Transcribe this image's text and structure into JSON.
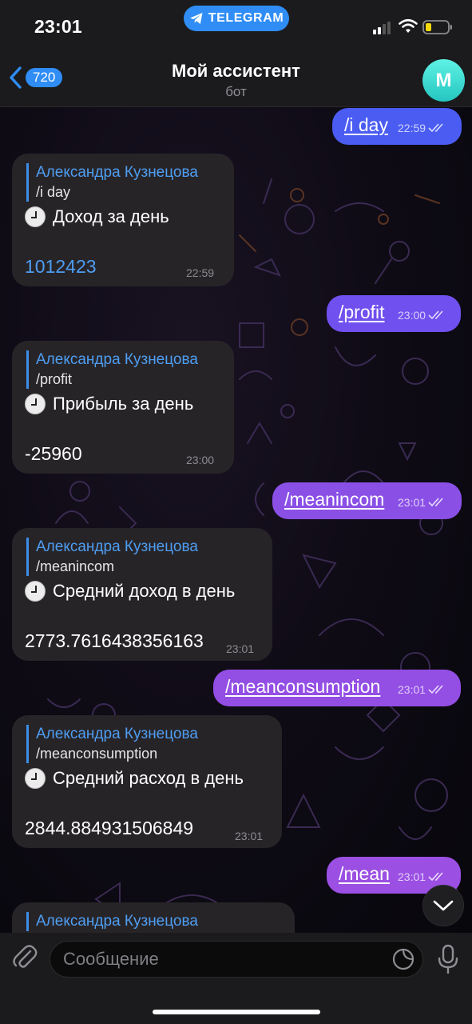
{
  "status_bar": {
    "time": "23:01",
    "pill_label": "TELEGRAM",
    "battery_color": "#f5d90a",
    "icons": [
      "signal-icon",
      "wifi-icon",
      "battery-icon"
    ]
  },
  "header": {
    "back_count": "720",
    "title": "Мой ассистент",
    "subtitle": "бот",
    "avatar_letter": "М",
    "accent": "#2f8df5"
  },
  "messages": [
    {
      "from": "me",
      "text": "/i day",
      "time": "22:59"
    },
    {
      "from": "bot",
      "reply_name": "Александра Кузнецова",
      "reply_text": "/i day",
      "title": "Доход за день",
      "value": "1012423",
      "value_is_link": true,
      "time": "22:59"
    },
    {
      "from": "me",
      "text": "/profit",
      "time": "23:00"
    },
    {
      "from": "bot",
      "reply_name": "Александра Кузнецова",
      "reply_text": "/profit",
      "title": "Прибыль за день",
      "value": "-25960",
      "time": "23:00"
    },
    {
      "from": "me",
      "text": "/meanincom",
      "time": "23:01"
    },
    {
      "from": "bot",
      "reply_name": "Александра Кузнецова",
      "reply_text": "/meanincom",
      "title": "Средний доход в день",
      "value": "2773.7616438356163",
      "time": "23:01"
    },
    {
      "from": "me",
      "text": "/meanconsumption",
      "time": "23:01"
    },
    {
      "from": "bot",
      "reply_name": "Александра Кузнецова",
      "reply_text": "/meanconsumption",
      "title": "Средний расход в день",
      "value": "2844.884931506849",
      "time": "23:01"
    },
    {
      "from": "me",
      "text": "/mean",
      "time": "23:01"
    },
    {
      "from": "bot",
      "reply_name": "Александра Кузнецова"
    }
  ],
  "colors": {
    "outgoing_blue": "#4a5cf2",
    "outgoing_purple": "#9b4fe3",
    "incoming_bg": "#272428",
    "link_blue": "#4e9ef2"
  },
  "composer": {
    "placeholder": "Сообщение"
  }
}
